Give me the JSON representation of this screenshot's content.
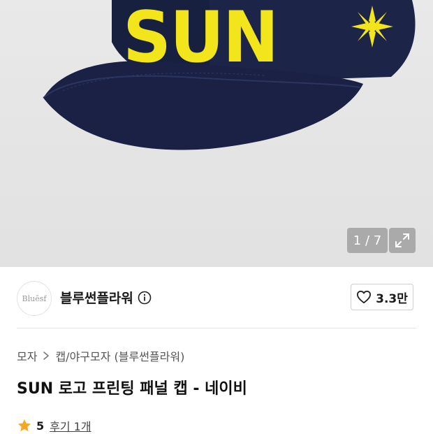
{
  "gallery": {
    "counter": "1 / 7",
    "logo_text": "SUN"
  },
  "brand": {
    "logo_text": "Bluēsf",
    "name": "블루썬플라워",
    "like_count": "3.3만"
  },
  "breadcrumb": {
    "items": [
      "모자",
      "캡/야구모자 (블루썬플라워)"
    ]
  },
  "product": {
    "title": "SUN 로고 프린팅 패널 캡 - 네이비",
    "rating": "5",
    "review_label": "후기 1개"
  },
  "colors": {
    "cap_navy": "#1c2447",
    "print_yellow": "#f2e51c",
    "star": "#f5a623"
  }
}
